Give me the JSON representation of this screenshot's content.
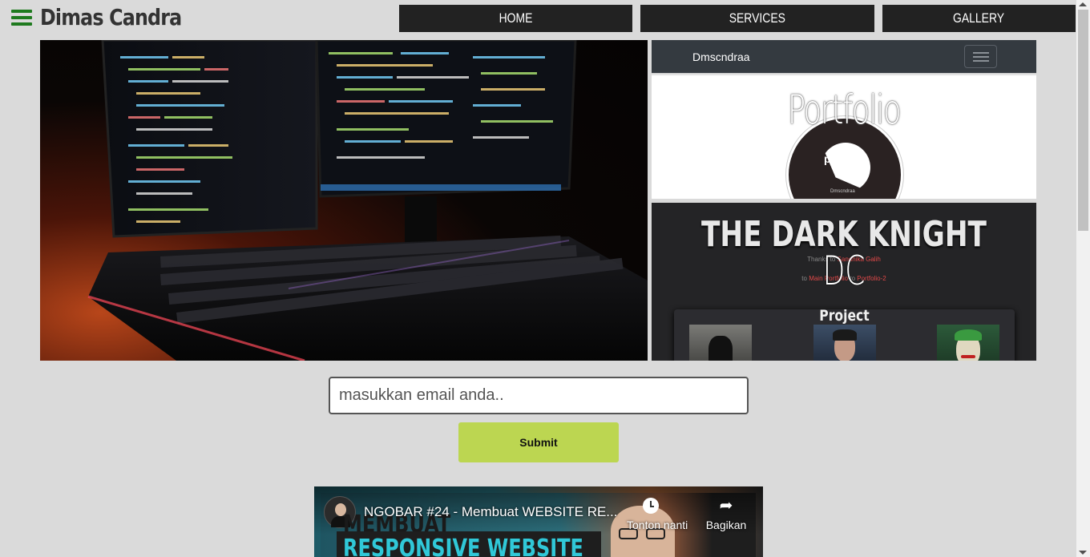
{
  "header": {
    "brand": "Dimas Candra",
    "nav": [
      {
        "label": "HOME"
      },
      {
        "label": "SERVICES"
      },
      {
        "label": "GALLERY"
      }
    ]
  },
  "gallery": {
    "tile1": {
      "nav_brand": "Dmscndraa",
      "heading": "Portfolio",
      "logo_text": "project",
      "logo_caption": "Dmscndraa"
    },
    "tile2": {
      "title": "THE DARK KNIGHT",
      "overlay": "DC",
      "thanks_prefix": "Thanks to",
      "thanks_name": "Sandhika Galih",
      "links_prefix": "to",
      "link1": "Main Portfolio",
      "link_sep": "to",
      "link2": "Portfolio-2",
      "project_title": "Project"
    }
  },
  "form": {
    "email_placeholder": "masukkan email anda..",
    "submit_label": "Submit"
  },
  "video": {
    "title": "NGOBAR #24 - Membuat WEBSITE RE...",
    "watch_later": "Tonton nanti",
    "share": "Bagikan",
    "thumb_line1": "MEMBUAT",
    "thumb_line2": "RESPONSIVE WEBSITE"
  },
  "colors": {
    "page_bg": "#dadada",
    "nav_bg": "#222222",
    "hamburger": "#1e7a1e",
    "submit_bg": "#bcd651"
  }
}
